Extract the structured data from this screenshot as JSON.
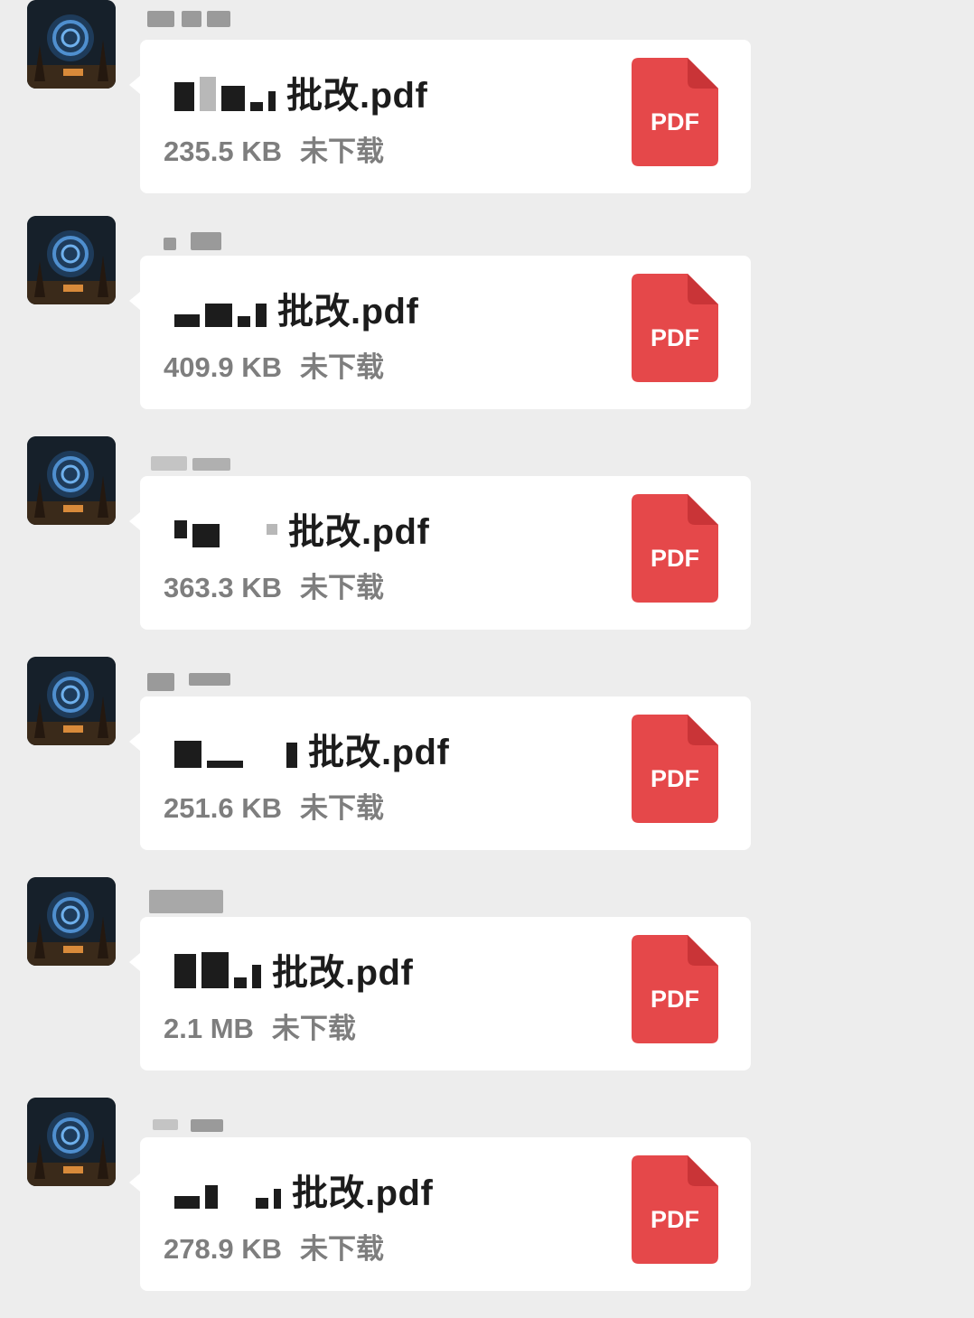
{
  "messages": [
    {
      "file_name": "批改.pdf",
      "size": "235.5 KB",
      "status": "未下载",
      "file_type": "PDF"
    },
    {
      "file_name": "批改.pdf",
      "size": "409.9 KB",
      "status": "未下载",
      "file_type": "PDF"
    },
    {
      "file_name": "批改.pdf",
      "size": "363.3 KB",
      "status": "未下载",
      "file_type": "PDF"
    },
    {
      "file_name": "批改.pdf",
      "size": "251.6 KB",
      "status": "未下载",
      "file_type": "PDF"
    },
    {
      "file_name": "批改.pdf",
      "size": "2.1 MB",
      "status": "未下载",
      "file_type": "PDF"
    },
    {
      "file_name": "批改.pdf",
      "size": "278.9 KB",
      "status": "未下载",
      "file_type": "PDF"
    }
  ],
  "colors": {
    "background": "#ededed",
    "bubble": "#ffffff",
    "pdf_red": "#e5484a",
    "pdf_fold": "#c93437",
    "meta_text": "#7e7e7e",
    "name_text": "#1c1c1c"
  },
  "icons": {
    "file_icon": "pdf-file-icon",
    "avatar": "night-sky-avatar"
  }
}
